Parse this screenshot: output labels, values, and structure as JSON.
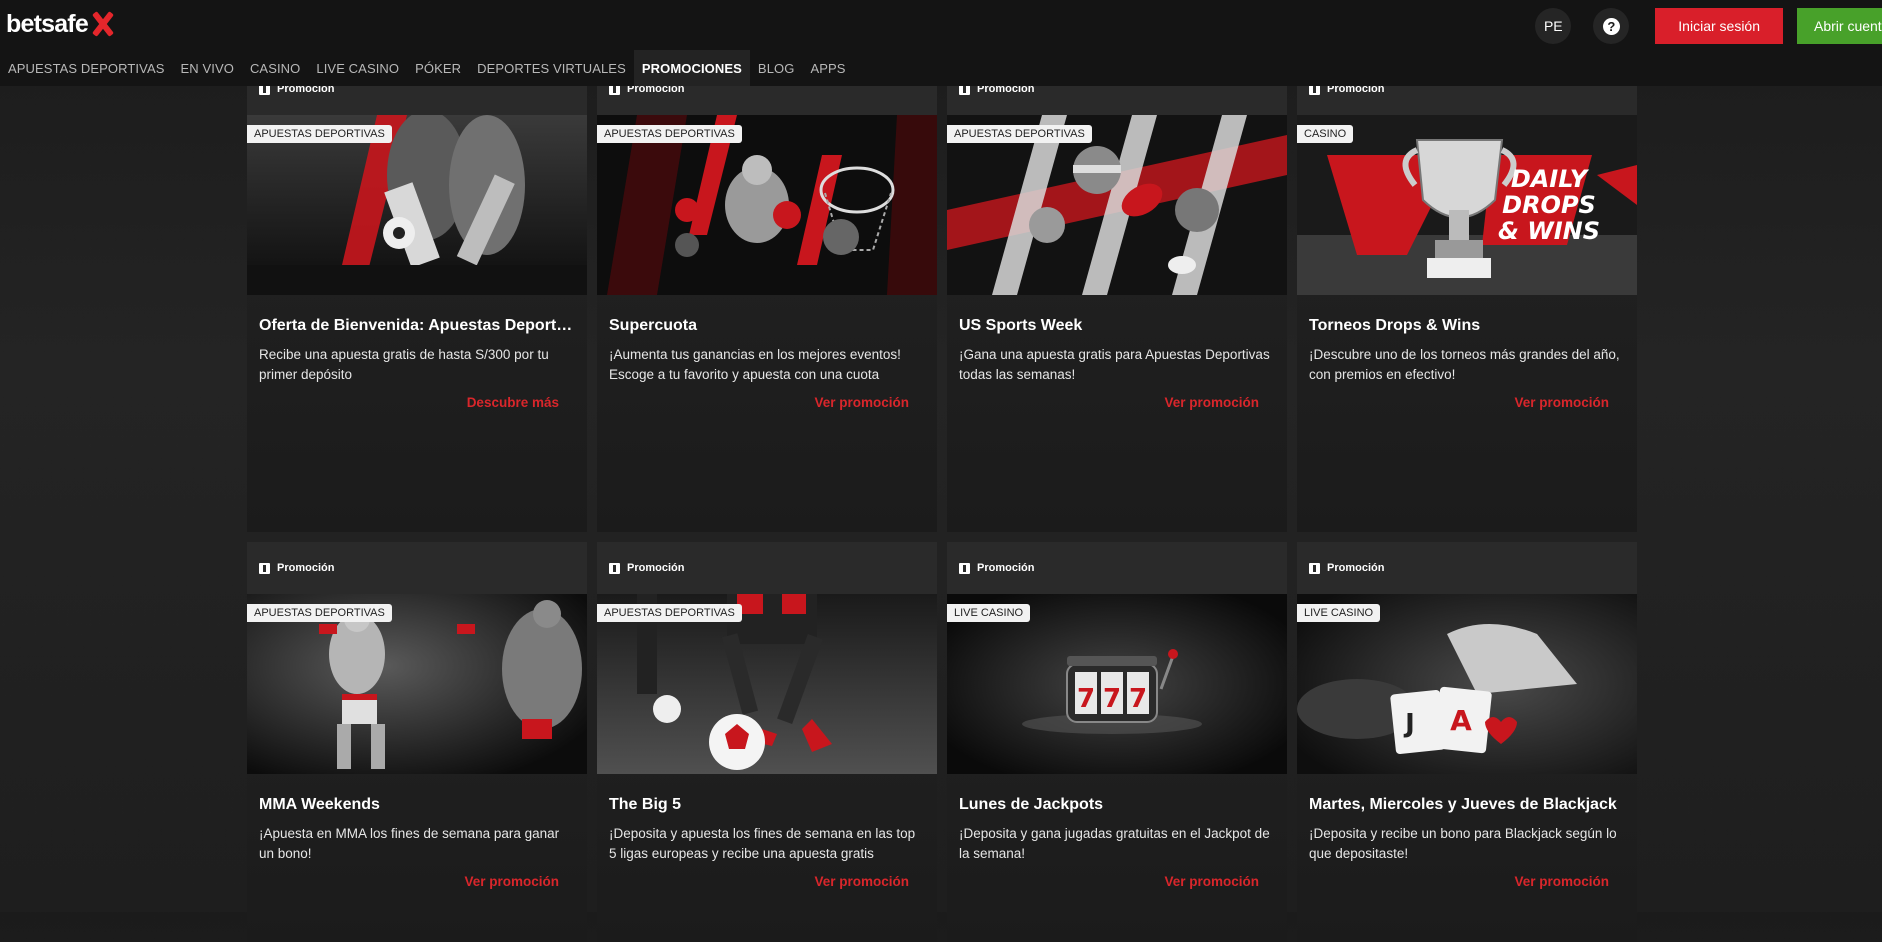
{
  "brand": {
    "name": "betsafe",
    "accent": "#e4262b"
  },
  "header": {
    "country": "PE",
    "help": "?",
    "login_label": "Iniciar sesión",
    "open_account_label": "Abrir cuent"
  },
  "nav": [
    {
      "label": "APUESTAS DEPORTIVAS"
    },
    {
      "label": "EN VIVO"
    },
    {
      "label": "CASINO"
    },
    {
      "label": "LIVE CASINO"
    },
    {
      "label": "PÓKER"
    },
    {
      "label": "DEPORTES VIRTUALES"
    },
    {
      "label": "PROMOCIONES",
      "active": true
    },
    {
      "label": "BLOG"
    },
    {
      "label": "APPS"
    }
  ],
  "cards": [
    {
      "head": "Promoción",
      "tag": "APUESTAS DEPORTIVAS",
      "title": "Oferta de Bienvenida: Apuestas Deportivas",
      "desc": "Recibe una apuesta gratis de hasta S/300 por tu primer depósito",
      "link": "Descubre más",
      "img": "soccer"
    },
    {
      "head": "Promoción",
      "tag": "APUESTAS DEPORTIVAS",
      "title": "Supercuota",
      "desc": "¡Aumenta tus ganancias en los mejores eventos! Escoge a tu favorito y apuesta con una cuota",
      "link": "Ver promoción",
      "img": "boxing"
    },
    {
      "head": "Promoción",
      "tag": "APUESTAS DEPORTIVAS",
      "title": "US Sports Week",
      "desc": "¡Gana una apuesta gratis para Apuestas Deportivas todas las semanas!",
      "link": "Ver promoción",
      "img": "usports"
    },
    {
      "head": "Promoción",
      "tag": "CASINO",
      "title": "Torneos Drops & Wins",
      "desc": "¡Descubre uno de los torneos más grandes del año, con premios en efectivo!",
      "link": "Ver promoción",
      "img": "drops",
      "img_text": [
        "DAILY",
        "DROPS",
        "& WINS"
      ]
    },
    {
      "head": "Promoción",
      "tag": "APUESTAS DEPORTIVAS",
      "title": "MMA Weekends",
      "desc": "¡Apuesta en MMA los fines de semana para ganar un bono!",
      "link": "Ver promoción",
      "img": "mma"
    },
    {
      "head": "Promoción",
      "tag": "APUESTAS DEPORTIVAS",
      "title": "The Big 5",
      "desc": "¡Deposita y apuesta los fines de semana en las top 5 ligas europeas y recibe una apuesta gratis",
      "link": "Ver promoción",
      "img": "big5"
    },
    {
      "head": "Promoción",
      "tag": "LIVE CASINO",
      "title": "Lunes de Jackpots",
      "desc": "¡Deposita y gana jugadas gratuitas en el Jackpot de la semana!",
      "link": "Ver promoción",
      "img": "slot",
      "img_text": [
        "7",
        "7",
        "7"
      ]
    },
    {
      "head": "Promoción",
      "tag": "LIVE CASINO",
      "title": "Martes, Miercoles y Jueves de Blackjack",
      "desc": "¡Deposita y recibe un bono para Blackjack según lo que depositaste!",
      "link": "Ver promoción",
      "img": "blackjack",
      "img_text": [
        "J",
        "A"
      ]
    }
  ]
}
